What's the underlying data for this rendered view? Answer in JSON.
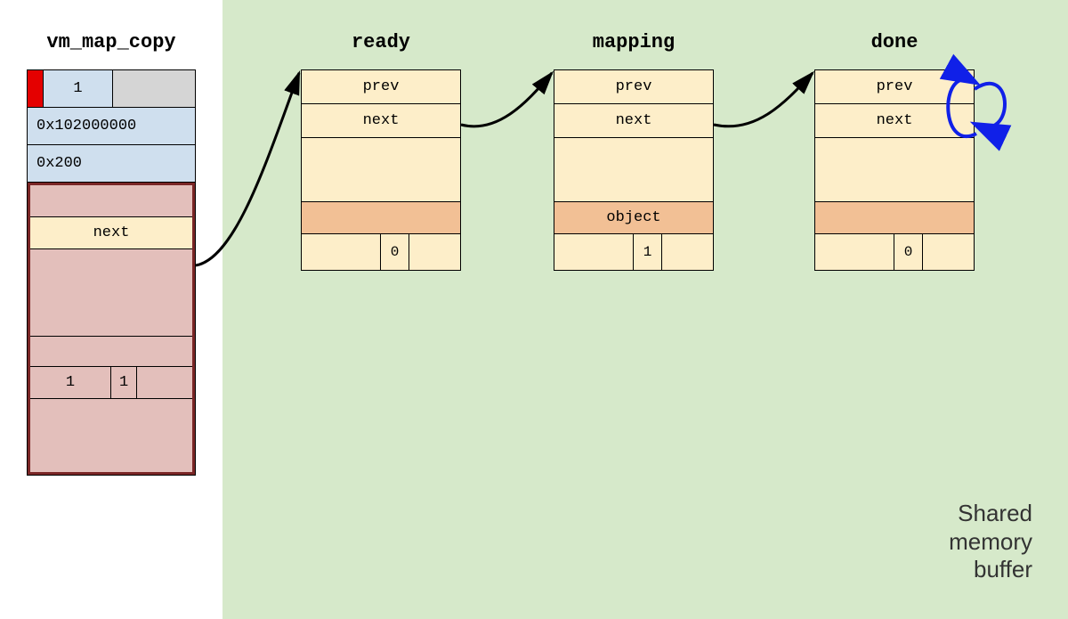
{
  "titles": {
    "vmcopy": "vm_map_copy",
    "ready": "ready",
    "mapping": "mapping",
    "done": "done"
  },
  "vmcopy": {
    "type_val": "1",
    "offset": "0x102000000",
    "size": "0x200",
    "fake": {
      "next_label": "next",
      "bits_left": "1",
      "bits_mid": "1"
    }
  },
  "entry": {
    "prev": "prev",
    "next": "next"
  },
  "ready": {
    "wired": "0"
  },
  "mapping": {
    "object_label": "object",
    "wired": "1"
  },
  "done": {
    "wired": "0"
  },
  "caption": {
    "line1": "Shared",
    "line2": "memory",
    "line3": "buffer"
  }
}
